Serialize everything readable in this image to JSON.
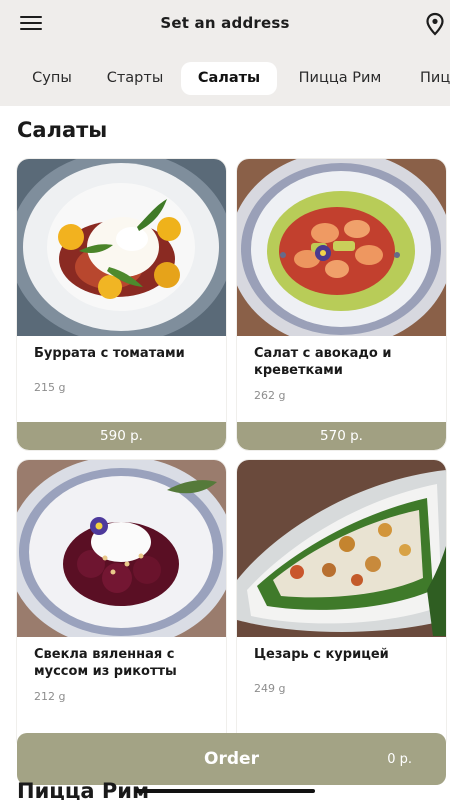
{
  "header": {
    "title": "Set an address",
    "menu_icon": "hamburger-menu-icon",
    "location_icon": "map-pin-icon"
  },
  "tabs": [
    {
      "label": "Супы",
      "active": false
    },
    {
      "label": "Старты",
      "active": false
    },
    {
      "label": "Салаты",
      "active": true
    },
    {
      "label": "Пицца Рим",
      "active": false
    },
    {
      "label": "Пиц",
      "active": false
    }
  ],
  "section": {
    "title": "Салаты"
  },
  "products": [
    {
      "name": "Буррата с томатами",
      "weight": "215 g",
      "price": "590 р."
    },
    {
      "name": "Салат с авокадо и креветками",
      "weight": "262 g",
      "price": "570 р."
    },
    {
      "name": "Свекла вяленная с муссом из рикотты",
      "weight": "212 g",
      "price": ""
    },
    {
      "name": "Цезарь с курицей",
      "weight": "249 g",
      "price": ""
    }
  ],
  "order": {
    "label": "Order",
    "total": "0 р."
  },
  "next_section": {
    "title": "Пицца Рим"
  },
  "colors": {
    "accent": "#a1a082",
    "top_background": "#efedeb",
    "page_background": "#ffffff"
  }
}
